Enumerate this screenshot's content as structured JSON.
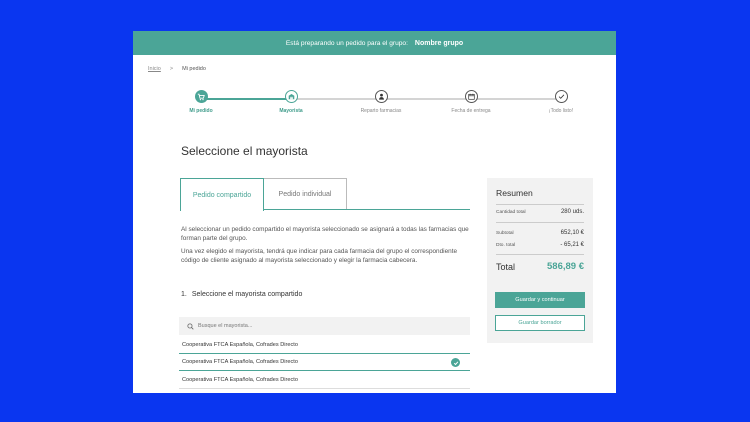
{
  "banner": {
    "text": "Está preparando un pedido para el grupo:",
    "group": "Nombre grupo"
  },
  "breadcrumb": {
    "home": "Inicio",
    "separator": ">",
    "current": "Mi pedido"
  },
  "steps": [
    {
      "label": "Mi pedido",
      "state": "done",
      "icon": "cart-icon"
    },
    {
      "label": "Mayorista",
      "state": "active",
      "icon": "warehouse-icon"
    },
    {
      "label": "Reparto farmacias",
      "state": "pending",
      "icon": "person-icon"
    },
    {
      "label": "Fecha de entrega",
      "state": "pending",
      "icon": "calendar-icon"
    },
    {
      "label": "¡Todo listo!",
      "state": "pending",
      "icon": "check-icon"
    }
  ],
  "page_title": "Seleccione el mayorista",
  "tabs": {
    "shared": "Pedido compartido",
    "individual": "Pedido individual"
  },
  "paragraphs": {
    "p1": "Al seleccionar un pedido compartido el mayorista seleccionado se asignará a todas las farmacias que forman parte del grupo.",
    "p2": "Una vez elegido el mayorista, tendrá que indicar para cada farmacia del grupo el correspondiente código de cliente asignado al mayorista seleccionado y elegir la farmacia cabecera."
  },
  "section": {
    "number": "1.",
    "title": "Seleccione el mayorista compartido"
  },
  "search": {
    "placeholder": "Busque el mayorista..."
  },
  "wholesalers": [
    {
      "name": "Cooperativa FTCA Española, Cofrades Directo",
      "selected": false
    },
    {
      "name": "Cooperativa FTCA Española, Cofrades Directo",
      "selected": true
    },
    {
      "name": "Cooperativa FTCA Española, Cofrades Directo",
      "selected": false
    }
  ],
  "summary": {
    "title": "Resumen",
    "quantity_label": "Cantidad total",
    "quantity_value": "280 uds.",
    "subtotal_label": "Subtotal",
    "subtotal_value": "652,10 €",
    "discount_label": "Dto. total",
    "discount_value": "- 65,21 €",
    "total_label": "Total",
    "total_value": "586,89 €",
    "primary_button": "Guardar y continuar",
    "secondary_button": "Guardar borrador"
  },
  "colors": {
    "accent": "#4ba597",
    "background": "#0a36f0",
    "panel": "#f2f2f2"
  }
}
